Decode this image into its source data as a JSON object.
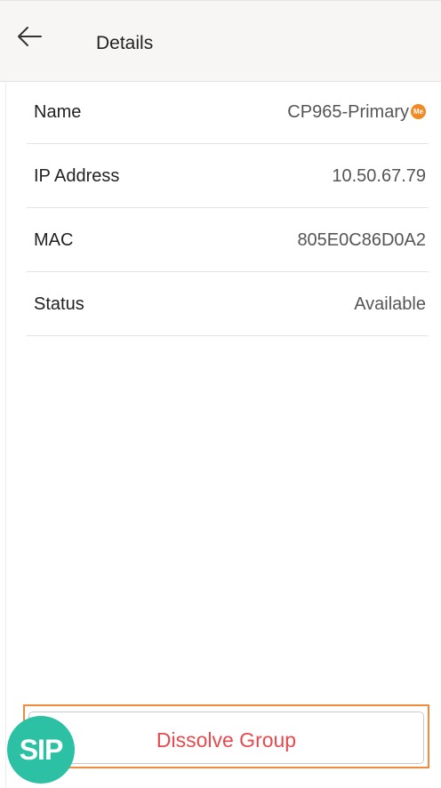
{
  "header": {
    "title": "Details",
    "back_icon": "arrow-left-icon"
  },
  "details": {
    "rows": [
      {
        "label": "Name",
        "value": "CP965-Primary",
        "badge": "Me"
      },
      {
        "label": "IP Address",
        "value": "10.50.67.79"
      },
      {
        "label": "MAC",
        "value": "805E0C86D0A2"
      },
      {
        "label": "Status",
        "value": "Available"
      }
    ]
  },
  "actions": {
    "dissolve_label": "Dissolve Group",
    "dissolve_color": "#e64a4f",
    "highlight_color": "#f08a3c"
  },
  "floating": {
    "sip_label": "SIP",
    "sip_color": "#2cc0a4"
  },
  "colors": {
    "badge": "#f08a24",
    "header_bg": "#f8f6f4"
  }
}
